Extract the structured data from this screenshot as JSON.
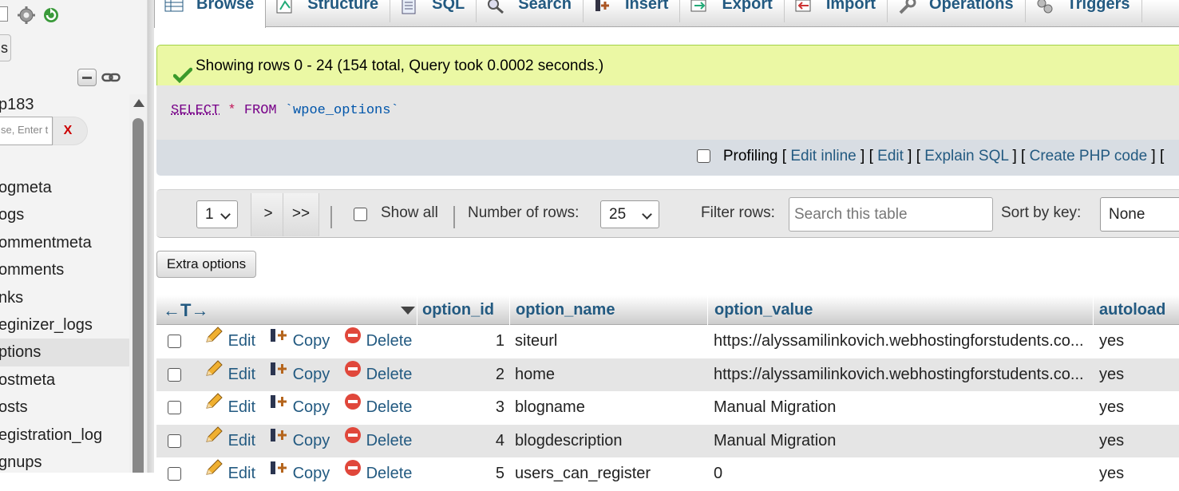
{
  "sidebar": {
    "btn_label": "s",
    "db_name": "p183",
    "filter_placeholder": "se, Enter t",
    "filter_clear": "X",
    "tables": [
      {
        "label": "ogmeta",
        "active": false
      },
      {
        "label": "ogs",
        "active": false
      },
      {
        "label": "ommentmeta",
        "active": false
      },
      {
        "label": "omments",
        "active": false
      },
      {
        "label": "nks",
        "active": false
      },
      {
        "label": "eginizer_logs",
        "active": false
      },
      {
        "label": "ptions",
        "active": true
      },
      {
        "label": "ostmeta",
        "active": false
      },
      {
        "label": "osts",
        "active": false
      },
      {
        "label": "egistration_log",
        "active": false
      },
      {
        "label": "gnups",
        "active": false
      }
    ]
  },
  "tabs": [
    {
      "label": "Browse",
      "icon": "browse-icon",
      "active": true
    },
    {
      "label": "Structure",
      "icon": "structure-icon",
      "active": false
    },
    {
      "label": "SQL",
      "icon": "sql-icon",
      "active": false
    },
    {
      "label": "Search",
      "icon": "search-icon",
      "active": false
    },
    {
      "label": "Insert",
      "icon": "insert-icon",
      "active": false
    },
    {
      "label": "Export",
      "icon": "export-icon",
      "active": false
    },
    {
      "label": "Import",
      "icon": "import-icon",
      "active": false
    },
    {
      "label": "Operations",
      "icon": "operations-icon",
      "active": false
    },
    {
      "label": "Triggers",
      "icon": "triggers-icon",
      "active": false
    }
  ],
  "result": {
    "message": "Showing rows 0 - 24 (154 total, Query took 0.0002 seconds.)"
  },
  "sql": {
    "select": "SELECT",
    "star": "*",
    "from": "FROM",
    "table": "`wpoe_options`"
  },
  "query_actions": {
    "profiling": "Profiling",
    "edit_inline": "Edit inline",
    "edit": "Edit",
    "explain": "Explain SQL",
    "php": "Create PHP code"
  },
  "navigation": {
    "page": "1",
    "next": ">",
    "last": ">>",
    "show_all": "Show all",
    "number_of_rows_label": "Number of rows:",
    "number_of_rows": "25",
    "filter_label": "Filter rows:",
    "filter_placeholder": "Search this table",
    "sort_label": "Sort by key:",
    "sort_value": "None"
  },
  "extra_options": "Extra options",
  "table": {
    "arrows": "←T→",
    "columns": [
      "option_id",
      "option_name",
      "option_value",
      "autoload"
    ],
    "action_labels": {
      "edit": "Edit",
      "copy": "Copy",
      "delete": "Delete"
    },
    "rows": [
      {
        "id": "1",
        "name": "siteurl",
        "value": "https://alyssamilinkovich.webhostingforstudents.co...",
        "autoload": "yes"
      },
      {
        "id": "2",
        "name": "home",
        "value": "https://alyssamilinkovich.webhostingforstudents.co...",
        "autoload": "yes"
      },
      {
        "id": "3",
        "name": "blogname",
        "value": "Manual Migration",
        "autoload": "yes"
      },
      {
        "id": "4",
        "name": "blogdescription",
        "value": "Manual Migration",
        "autoload": "yes"
      },
      {
        "id": "5",
        "name": "users_can_register",
        "value": "0",
        "autoload": "yes"
      }
    ]
  }
}
